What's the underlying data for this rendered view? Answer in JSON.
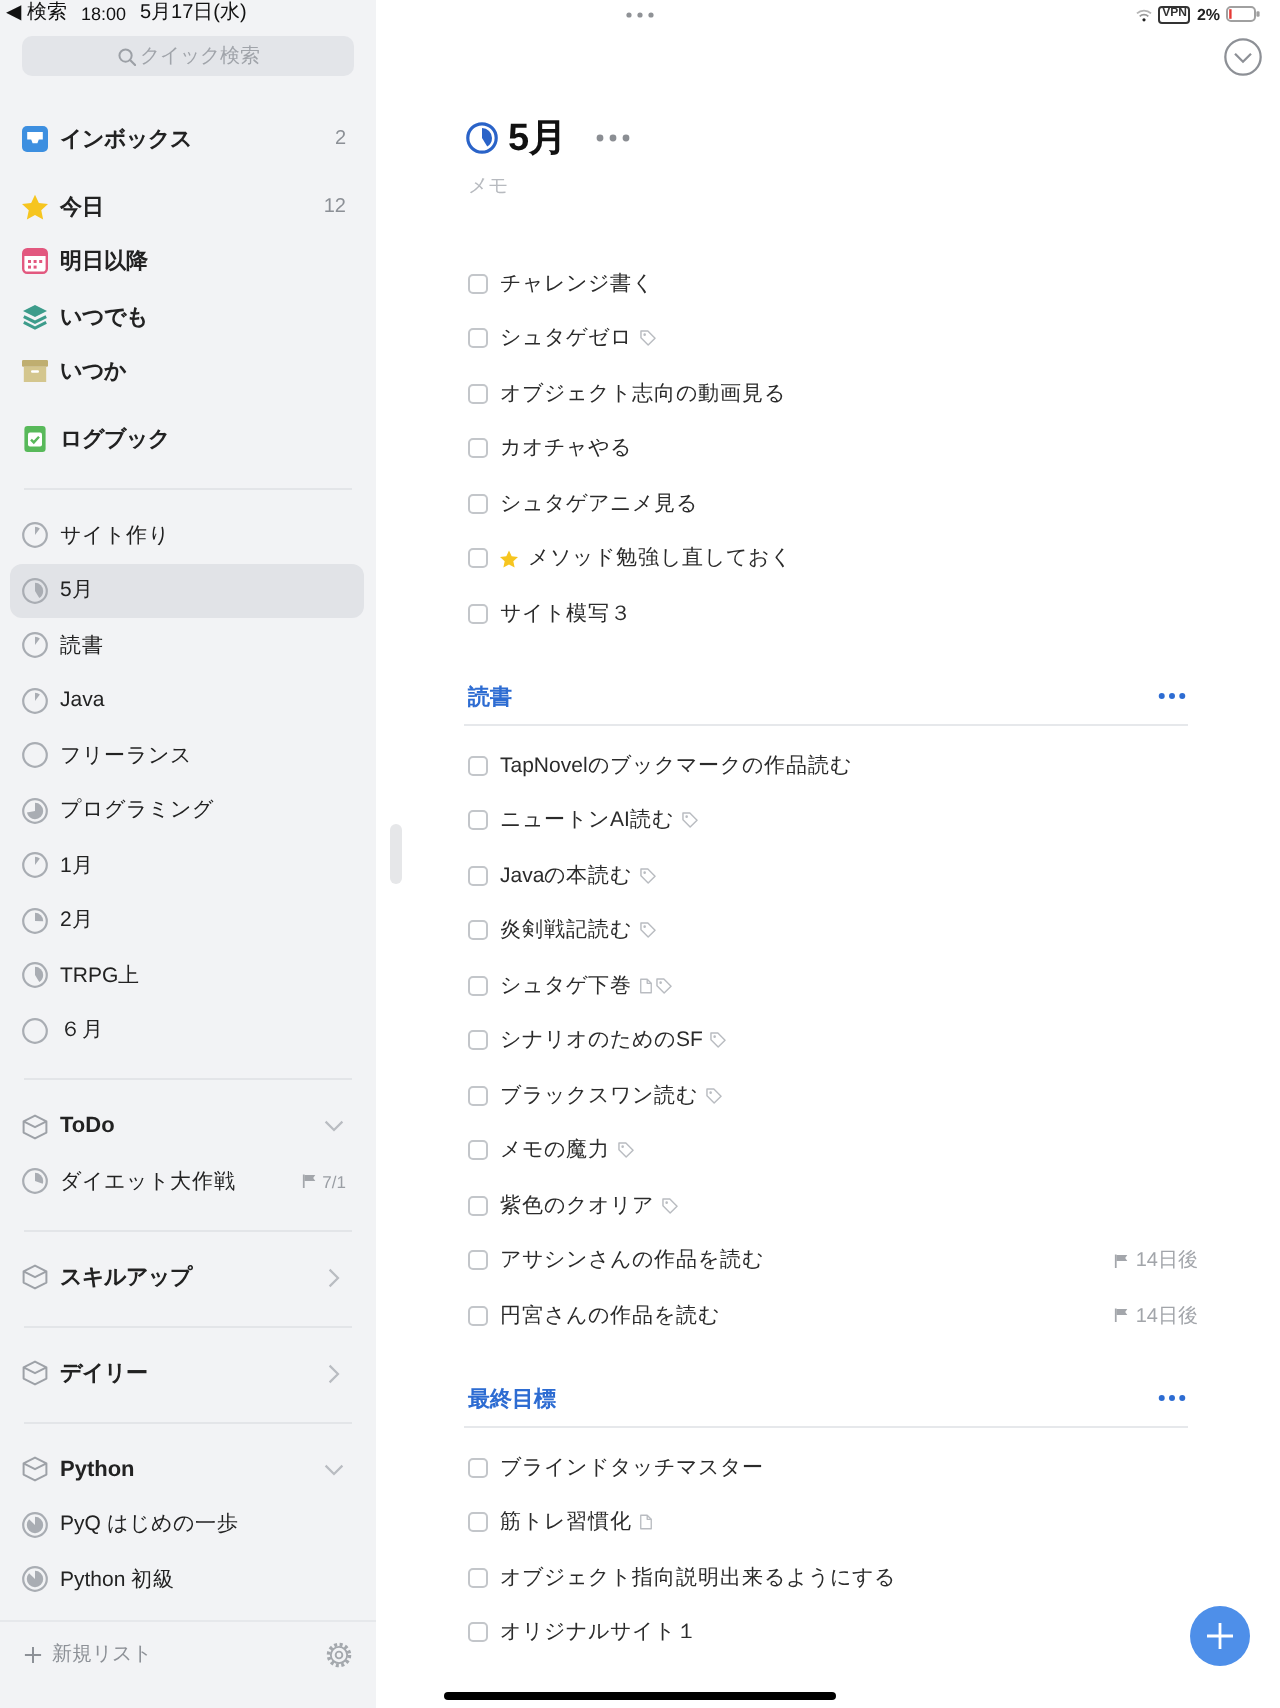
{
  "status_bar": {
    "back": "◀ 検索",
    "time": "18:00",
    "date": "5月17日(水)",
    "vpn": "VPN",
    "battery": "2%"
  },
  "sidebar": {
    "search": {
      "placeholder": "クイック検索"
    },
    "groups": [
      [
        {
          "kind": "inbox",
          "label": "インボックス",
          "count": "2",
          "selected": false
        }
      ],
      [
        {
          "kind": "today",
          "label": "今日",
          "count": "12",
          "selected": false
        },
        {
          "kind": "upcoming",
          "label": "明日以降",
          "selected": false
        },
        {
          "kind": "anytime",
          "label": "いつでも",
          "selected": false
        },
        {
          "kind": "someday",
          "label": "いつか",
          "selected": false
        }
      ],
      [
        {
          "kind": "logbook",
          "label": "ログブック",
          "selected": false
        }
      ]
    ],
    "projects": [
      {
        "name": "サイト作り",
        "level": 0.1,
        "selected": false
      },
      {
        "name": "5月",
        "level": 0.4,
        "selected": true
      },
      {
        "name": "読書",
        "level": 0.1,
        "selected": false
      },
      {
        "name": "Java",
        "level": 0.1,
        "selected": false
      },
      {
        "name": "フリーランス",
        "level": 0,
        "selected": false
      },
      {
        "name": "プログラミング",
        "level": 0.7,
        "selected": false
      },
      {
        "name": "1月",
        "level": 0.1,
        "selected": false
      },
      {
        "name": "2月",
        "level": 0.25,
        "selected": false
      },
      {
        "name": "TRPG上",
        "level": 0.4,
        "selected": false
      },
      {
        "name": "６月",
        "level": 0,
        "selected": false
      }
    ],
    "areas": [
      {
        "name": "ToDo",
        "expanded": true,
        "projects": [
          {
            "name": "ダイエット大作戦",
            "level": 0.3,
            "deadline": "7/1",
            "selected": false
          }
        ]
      },
      {
        "name": "スキルアップ",
        "expanded": false
      },
      {
        "name": "デイリー",
        "expanded": false
      },
      {
        "name": "Python",
        "expanded": true,
        "projects": [
          {
            "name": "PyQ はじめの一歩",
            "level": 0.85,
            "selected": false
          },
          {
            "name": "Python 初級",
            "level": 0.85,
            "selected": false
          }
        ]
      }
    ],
    "new_list": "新規リスト"
  },
  "project": {
    "title": "5月",
    "level": 0.4,
    "notes_placeholder": "メモ"
  },
  "tasks": [
    {
      "title": "チャレンジ書く",
      "checked": false,
      "today": false,
      "note": false,
      "tag": false
    },
    {
      "title": "シュタゲゼロ",
      "checked": false,
      "today": false,
      "note": false,
      "tag": true
    },
    {
      "title": "オブジェクト志向の動画見る",
      "checked": false,
      "today": false,
      "note": false,
      "tag": false
    },
    {
      "title": "カオチャやる",
      "checked": false,
      "today": false,
      "note": false,
      "tag": false
    },
    {
      "title": "シュタゲアニメ見る",
      "checked": false,
      "today": false,
      "note": false,
      "tag": false
    },
    {
      "title": "メソッド勉強し直しておく",
      "checked": false,
      "today": true,
      "note": false,
      "tag": false
    },
    {
      "title": "サイト模写３",
      "checked": false,
      "today": false,
      "note": false,
      "tag": false
    }
  ],
  "headings": [
    {
      "title": "読書",
      "tasks": [
        {
          "title": "TapNovelのブックマークの作品読む",
          "checked": false,
          "today": false,
          "note": false,
          "tag": false
        },
        {
          "title": "ニュートンAI読む",
          "checked": false,
          "today": false,
          "note": false,
          "tag": true
        },
        {
          "title": "Javaの本読む",
          "checked": false,
          "today": false,
          "note": false,
          "tag": true
        },
        {
          "title": "炎剣戦記読む",
          "checked": false,
          "today": false,
          "note": false,
          "tag": true
        },
        {
          "title": "シュタゲ下巻",
          "checked": false,
          "today": false,
          "note": true,
          "tag": true
        },
        {
          "title": "シナリオのためのSF",
          "checked": false,
          "today": false,
          "note": false,
          "tag": true
        },
        {
          "title": "ブラックスワン読む",
          "checked": false,
          "today": false,
          "note": false,
          "tag": true
        },
        {
          "title": "メモの魔力",
          "checked": false,
          "today": false,
          "note": false,
          "tag": true
        },
        {
          "title": "紫色のクオリア",
          "checked": false,
          "today": false,
          "note": false,
          "tag": true
        },
        {
          "title": "アサシンさんの作品を読む",
          "checked": false,
          "today": false,
          "note": false,
          "tag": false,
          "deadline": "14日後"
        },
        {
          "title": "円宮さんの作品を読む",
          "checked": false,
          "today": false,
          "note": false,
          "tag": false,
          "deadline": "14日後"
        }
      ]
    },
    {
      "title": "最終目標",
      "tasks": [
        {
          "title": "ブラインドタッチマスター",
          "checked": false,
          "today": false,
          "note": false,
          "tag": false
        },
        {
          "title": "筋トレ習慣化",
          "checked": false,
          "today": false,
          "note": true,
          "tag": false
        },
        {
          "title": "オブジェクト指向説明出来るようにする",
          "checked": false,
          "today": false,
          "note": false,
          "tag": false
        },
        {
          "title": "オリジナルサイト１",
          "checked": false,
          "today": false,
          "note": false,
          "tag": false
        }
      ]
    }
  ]
}
